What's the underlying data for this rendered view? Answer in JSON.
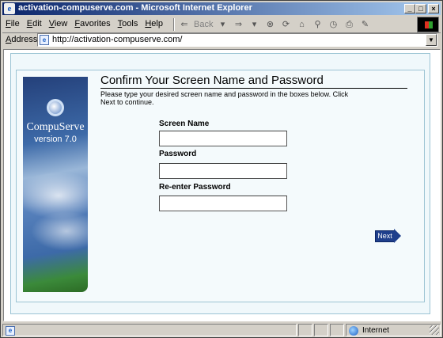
{
  "window": {
    "title": "activation-compuserve.com - Microsoft Internet Explorer",
    "min_glyph": "_",
    "max_glyph": "□",
    "close_glyph": "×"
  },
  "menu": [
    "File",
    "Edit",
    "View",
    "Favorites",
    "Tools",
    "Help"
  ],
  "toolbar": {
    "back_label": "Back",
    "icons": [
      "back-arrow-icon",
      "forward-arrow-icon",
      "stop-icon",
      "refresh-icon",
      "home-icon",
      "search-icon",
      "history-icon",
      "print-icon",
      "edit-icon"
    ]
  },
  "address": {
    "label": "Address",
    "url": "http://activation-compuserve.com/"
  },
  "sidebar": {
    "brand": "CompuServe",
    "version": "version 7.0"
  },
  "form": {
    "title": "Confirm Your Screen Name and Password",
    "instructions": "Please type your desired screen name and password in the boxes below. Click Next to continue.",
    "fields": [
      {
        "label": "Screen Name",
        "value": ""
      },
      {
        "label": "Password",
        "value": ""
      },
      {
        "label": "Re-enter Password",
        "value": ""
      }
    ],
    "next_label": "Next"
  },
  "status": {
    "zone": "Internet"
  },
  "colors": {
    "titlebar_start": "#0a246a",
    "titlebar_end": "#a6caf0",
    "next_button": "#1f3f8c",
    "frame_border": "#9cc4d4"
  }
}
